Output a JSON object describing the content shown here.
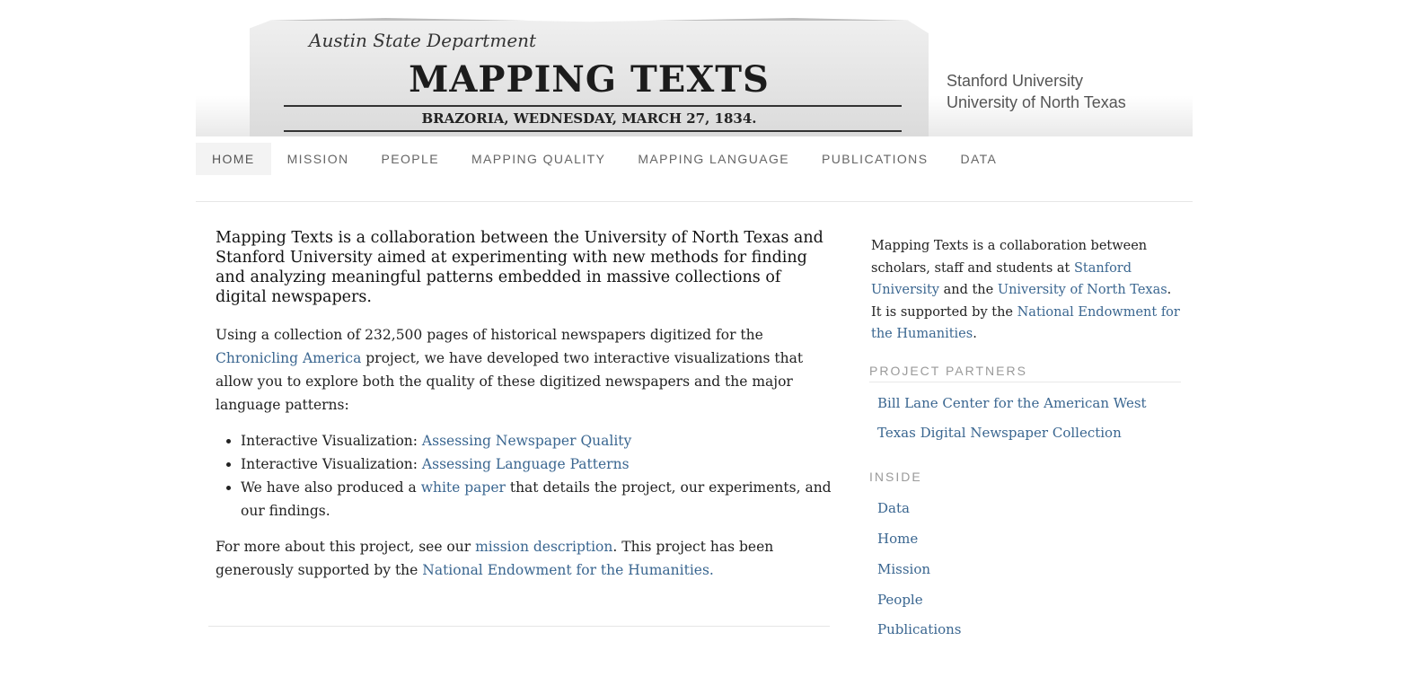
{
  "header": {
    "banner_script": "Austin State Department",
    "banner_title": "MAPPING TEXTS",
    "banner_subtitle": "BRAZORIA, WEDNESDAY, MARCH 27, 1834.",
    "institutions": [
      "Stanford University",
      "University of North Texas"
    ]
  },
  "nav": {
    "items": [
      {
        "label": "HOME",
        "active": true
      },
      {
        "label": "MISSION"
      },
      {
        "label": "PEOPLE"
      },
      {
        "label": "MAPPING QUALITY"
      },
      {
        "label": "MAPPING LANGUAGE"
      },
      {
        "label": "PUBLICATIONS"
      },
      {
        "label": "DATA"
      }
    ]
  },
  "main": {
    "lead": "Mapping Texts is a collaboration between the University of North Texas and Stanford University aimed at experimenting with new methods for finding and analyzing meaningful patterns embedded in massive collections of digital newspapers.",
    "p2": {
      "before": "Using a collection of 232,500 pages of historical newspapers digitized for the ",
      "link": "Chronicling America",
      "after": " project, we have developed two interactive visualizations that allow you to explore both the quality of these digitized newspapers and the major language patterns:"
    },
    "bullets": [
      {
        "before": "Interactive Visualization: ",
        "link": "Assessing Newspaper Quality",
        "after": ""
      },
      {
        "before": "Interactive Visualization: ",
        "link": "Assessing Language Patterns",
        "after": ""
      },
      {
        "before": "We have also produced a ",
        "link": "white paper",
        "after": " that details the project, our experiments, and our findings."
      }
    ],
    "p3": {
      "before": "For more about this project, see our ",
      "link1": "mission description",
      "middle": ". This project has been generously supported by the ",
      "link2": "National Endowment for the Humanities."
    }
  },
  "sidebar": {
    "intro": {
      "t1": "Mapping Texts is a collaboration between scholars, staff and students at ",
      "l1": "Stanford University",
      "t2": " and the ",
      "l2": "University of North Texas",
      "t3": ". It is supported by the ",
      "l3": "National Endowment for the Humanities",
      "t4": "."
    },
    "partners_heading": "PROJECT PARTNERS",
    "partners": [
      "Bill Lane Center for the American West",
      "Texas Digital Newspaper Collection"
    ],
    "inside_heading": "INSIDE",
    "inside": [
      "Data",
      "Home",
      "Mission",
      "People",
      "Publications"
    ]
  },
  "colors": {
    "link": "#3a6690",
    "nav_text": "#666666",
    "heading_gray": "#9a9a9a"
  }
}
